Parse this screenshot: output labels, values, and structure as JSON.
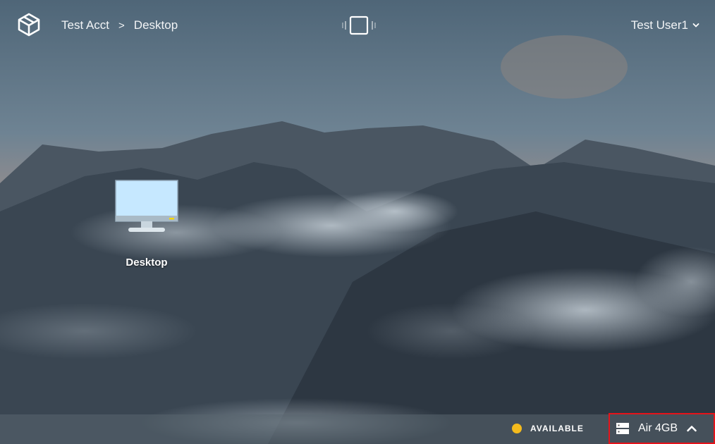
{
  "breadcrumb": {
    "account": "Test Acct",
    "separator": ">",
    "current": "Desktop"
  },
  "user": {
    "name": "Test User1"
  },
  "desktop_icon": {
    "label": "Desktop"
  },
  "status": {
    "text": "AVAILABLE",
    "color": "#f4bb1d"
  },
  "plan": {
    "label": "Air 4GB"
  },
  "colors": {
    "highlight_border": "#e5131a",
    "monitor_screen": "#c6e8ff"
  },
  "icons": [
    "cube-logo-icon",
    "view-toggle-icon",
    "chevron-down-icon",
    "monitor-icon",
    "server-icon",
    "chevron-up-icon"
  ]
}
